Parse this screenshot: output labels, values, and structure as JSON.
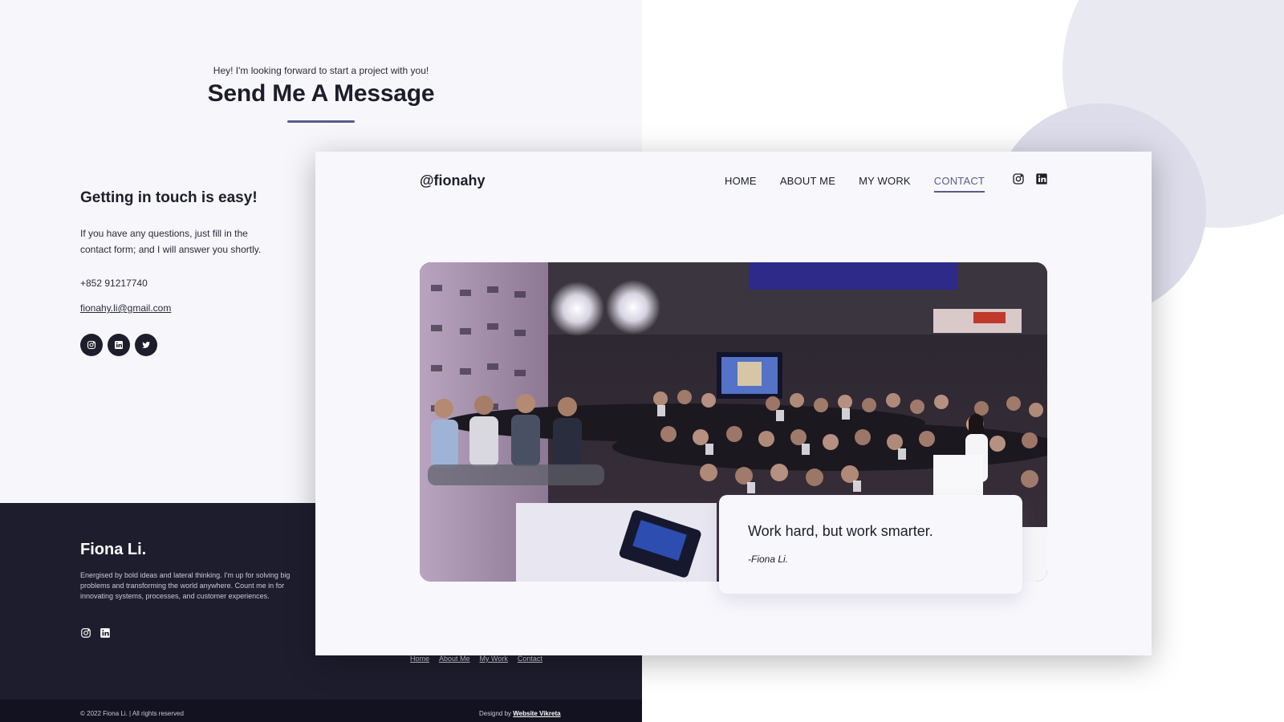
{
  "contact": {
    "eyebrow": "Hey! I'm looking forward to start a project with you!",
    "title": "Send Me A Message",
    "getting_title": "Getting in touch is easy!",
    "description": "If you have any questions, just fill in the contact form; and I will answer you shortly.",
    "phone": "+852 91217740",
    "email": "fionahy.li@gmail.com",
    "social_icons": [
      "instagram-icon",
      "linkedin-icon",
      "twitter-icon"
    ]
  },
  "footer": {
    "name": "Fiona Li.",
    "description": "Energised by bold ideas and lateral thinking. I'm up for solving big problems and transforming the world anywhere. Count me in for innovating systems, processes, and customer experiences.",
    "social_icons": [
      "instagram-icon",
      "linkedin-icon"
    ],
    "links": [
      "Home",
      "About Me",
      "My Work",
      "Contact"
    ],
    "copyright": "© 2022 Fiona Li. | All rights reserved",
    "design_prefix": "Designd by",
    "design_link": "Website Vikreta"
  },
  "home": {
    "logo": "@fionahy",
    "nav": [
      "HOME",
      "ABOUT ME",
      "MY WORK",
      "CONTACT"
    ],
    "active_nav": "CONTACT",
    "header_icons": [
      "instagram-icon",
      "linkedin-icon"
    ],
    "quote": "Work hard, but work smarter.",
    "quote_author": "-Fiona Li."
  },
  "colors": {
    "accent": "#5a5a8e",
    "dark": "#1e1d2e",
    "light_bg": "#f7f7fb"
  }
}
